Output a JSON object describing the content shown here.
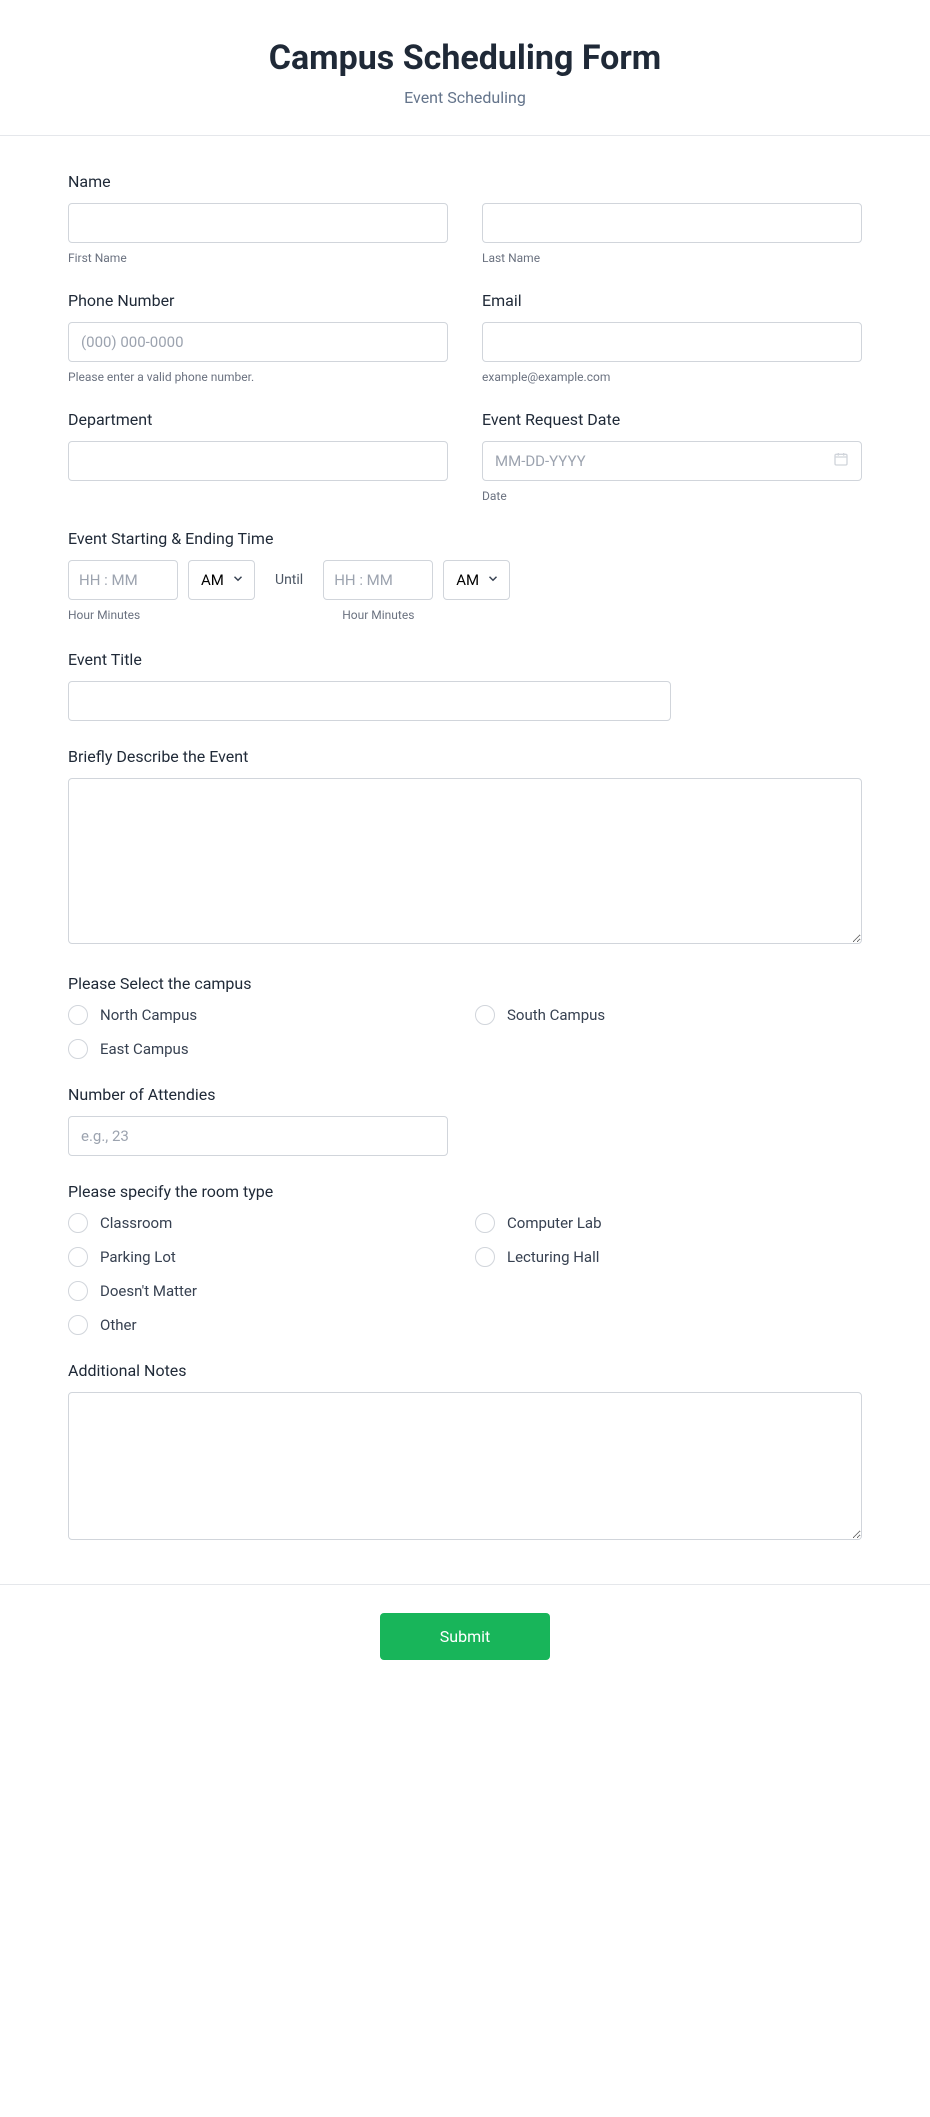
{
  "header": {
    "title": "Campus Scheduling Form",
    "subtitle": "Event Scheduling"
  },
  "name": {
    "label": "Name",
    "first_sub": "First Name",
    "last_sub": "Last Name"
  },
  "phone": {
    "label": "Phone Number",
    "placeholder": "(000) 000-0000",
    "sub": "Please enter a valid phone number."
  },
  "email": {
    "label": "Email",
    "sub": "example@example.com"
  },
  "department": {
    "label": "Department"
  },
  "event_date": {
    "label": "Event Request Date",
    "placeholder": "MM-DD-YYYY",
    "sub": "Date"
  },
  "event_time": {
    "label": "Event Starting & Ending Time",
    "time_placeholder": "HH : MM",
    "ampm": "AM",
    "until": "Until",
    "sub": "Hour Minutes"
  },
  "event_title": {
    "label": "Event Title"
  },
  "describe": {
    "label": "Briefly Describe the Event"
  },
  "campus": {
    "label": "Please Select the campus",
    "options": [
      "North Campus",
      "South Campus",
      "East Campus"
    ]
  },
  "attendees": {
    "label": "Number of Attendies",
    "placeholder": "e.g., 23"
  },
  "room_type": {
    "label": "Please specify the room type",
    "options": [
      "Classroom",
      "Computer Lab",
      "Parking Lot",
      "Lecturing Hall",
      "Doesn't Matter",
      "Other"
    ]
  },
  "notes": {
    "label": "Additional Notes"
  },
  "submit": {
    "label": "Submit"
  }
}
